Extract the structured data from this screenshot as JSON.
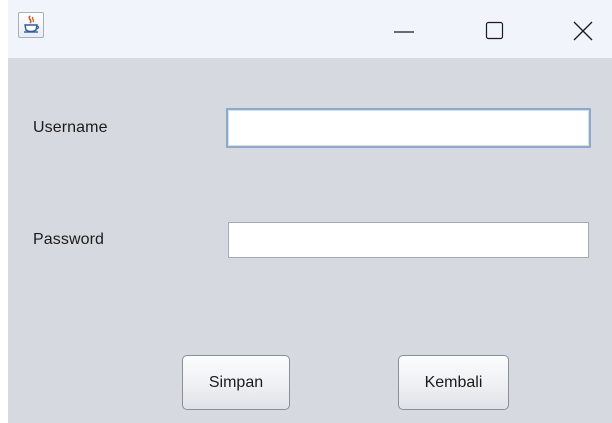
{
  "window": {
    "title": "",
    "app_icon": "java-cup-icon",
    "controls": {
      "minimize": "minimize-icon",
      "maximize": "maximize-icon",
      "close": "close-icon"
    }
  },
  "form": {
    "username_label": "Username",
    "username_value": "",
    "password_label": "Password",
    "password_value": ""
  },
  "buttons": {
    "save_label": "Simpan",
    "back_label": "Kembali"
  },
  "colors": {
    "window_background": "#d7d9e0",
    "titlebar_background": "#f1f4fb",
    "focus_border": "#8fa9c9"
  }
}
